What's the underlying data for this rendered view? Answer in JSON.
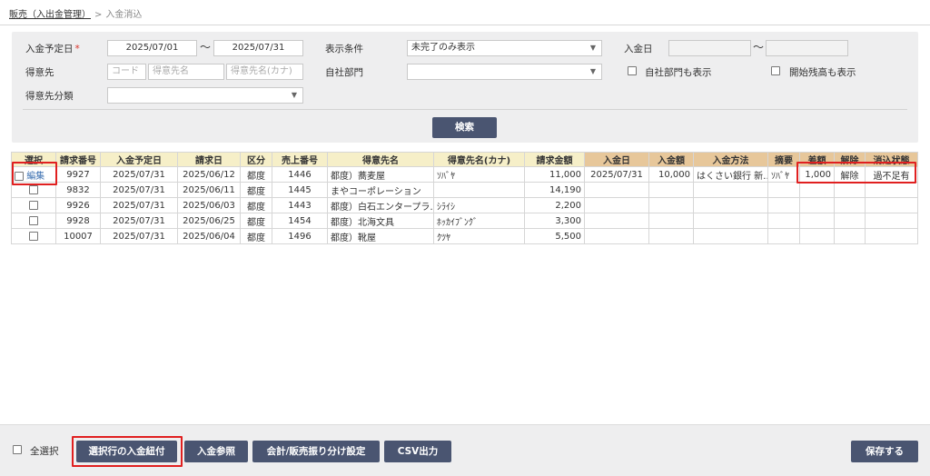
{
  "breadcrumb": {
    "parent": "販売（入出金管理）",
    "separator": ">",
    "current": "入金消込"
  },
  "search": {
    "due_date_label": "入金予定日",
    "required_mark": "*",
    "due_date_from": "2025/07/01",
    "due_date_to": "2025/07/31",
    "range_sep": "〜",
    "display_cond_label": "表示条件",
    "display_cond_value": "未完了のみ表示",
    "payment_date_label": "入金日",
    "customer_label": "得意先",
    "customer_code_ph": "コード",
    "customer_name_ph": "得意先名",
    "customer_kana_ph": "得意先名(カナ)",
    "dept_label": "自社部門",
    "show_dept_label": "自社部門も表示",
    "show_opening_label": "開始残高も表示",
    "customer_cat_label": "得意先分類",
    "search_button": "検索"
  },
  "table": {
    "headers": [
      "選択",
      "請求番号",
      "入金予定日",
      "請求日",
      "区分",
      "売上番号",
      "得意先名",
      "得意先名(カナ)",
      "請求金額",
      "入金日",
      "入金額",
      "入金方法",
      "摘要",
      "差額",
      "解除",
      "消込状態"
    ],
    "edit_label": "編集",
    "rows": [
      {
        "invoice": "9927",
        "due": "2025/07/31",
        "bill": "2025/06/12",
        "kubun": "都度",
        "sale": "1446",
        "name": "都度）蕎麦屋",
        "kana": "ｿﾊﾞﾔ",
        "amount": "11,000",
        "pay_date": "2025/07/31",
        "pay_amount": "10,000",
        "method": "はくさい銀行 新…",
        "memo": "ｿﾊﾞﾔ",
        "diff": "1,000",
        "cancel": "解除",
        "status": "過不足有"
      },
      {
        "invoice": "9832",
        "due": "2025/07/31",
        "bill": "2025/06/11",
        "kubun": "都度",
        "sale": "1445",
        "name": "まやコーポレーション",
        "kana": "",
        "amount": "14,190",
        "pay_date": "",
        "pay_amount": "",
        "method": "",
        "memo": "",
        "diff": "",
        "cancel": "",
        "status": ""
      },
      {
        "invoice": "9926",
        "due": "2025/07/31",
        "bill": "2025/06/03",
        "kubun": "都度",
        "sale": "1443",
        "name": "都度）白石エンタープラ…",
        "kana": "ｼﾗｲｼ",
        "amount": "2,200",
        "pay_date": "",
        "pay_amount": "",
        "method": "",
        "memo": "",
        "diff": "",
        "cancel": "",
        "status": ""
      },
      {
        "invoice": "9928",
        "due": "2025/07/31",
        "bill": "2025/06/25",
        "kubun": "都度",
        "sale": "1454",
        "name": "都度）北海文具",
        "kana": "ﾎｯｶｲﾌﾞﾝｸﾞ",
        "amount": "3,300",
        "pay_date": "",
        "pay_amount": "",
        "method": "",
        "memo": "",
        "diff": "",
        "cancel": "",
        "status": ""
      },
      {
        "invoice": "10007",
        "due": "2025/07/31",
        "bill": "2025/06/04",
        "kubun": "都度",
        "sale": "1496",
        "name": "都度）靴屋",
        "kana": "ｸﾂﾔ",
        "amount": "5,500",
        "pay_date": "",
        "pay_amount": "",
        "method": "",
        "memo": "",
        "diff": "",
        "cancel": "",
        "status": ""
      }
    ]
  },
  "footer": {
    "select_all_label": "全選択",
    "link_button": "選択行の入金紐付",
    "ref_button": "入金参照",
    "split_button": "会計/販売振り分け設定",
    "csv_button": "CSV出力",
    "save_button": "保存する"
  },
  "colors": {
    "header_yellow": "#f6efc8",
    "header_orange": "#e7c79a",
    "button_dark": "#4a5571",
    "highlight_red": "#e02020",
    "link_blue": "#3a6fb0"
  }
}
